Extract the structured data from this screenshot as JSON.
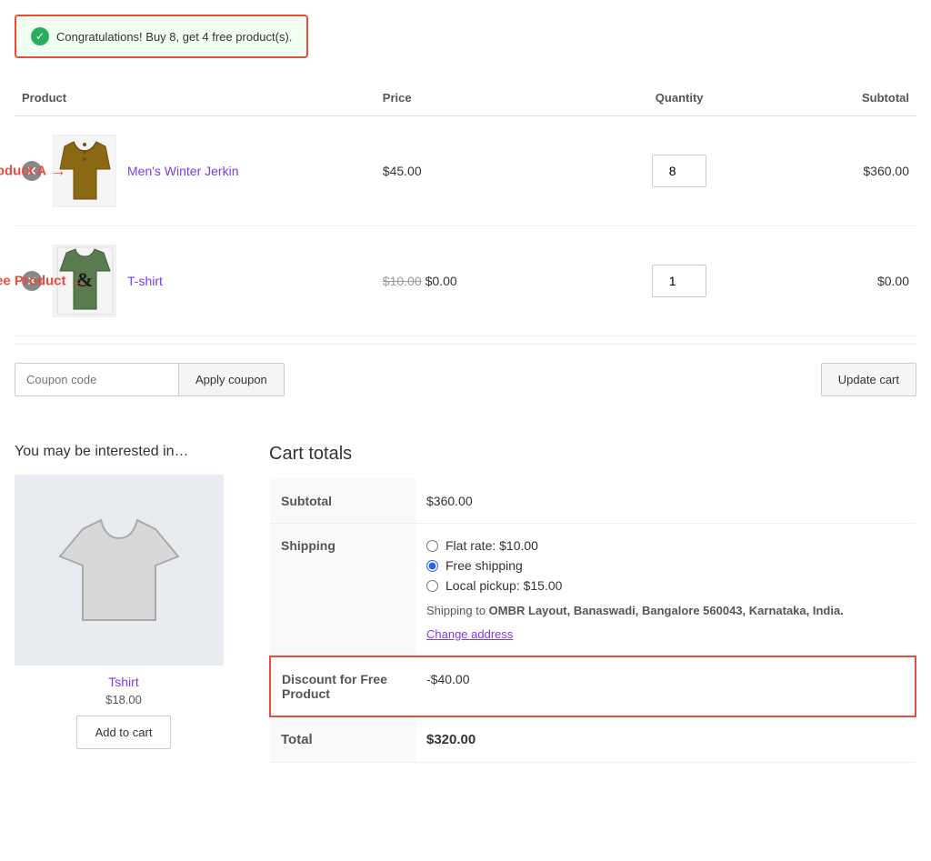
{
  "banner": {
    "message": "Congratulations! Buy 8, get 4 free product(s)."
  },
  "cart": {
    "columns": {
      "product": "Product",
      "price": "Price",
      "quantity": "Quantity",
      "subtotal": "Subtotal"
    },
    "items": [
      {
        "id": "mens-winter-jerkin",
        "name": "Men's Winter Jerkin",
        "price": "$45.00",
        "original_price": null,
        "discounted_price": null,
        "quantity": 8,
        "subtotal": "$360.00",
        "annotation_label": "Product A",
        "annotation_type": "product-a"
      },
      {
        "id": "tshirt",
        "name": "T-shirt",
        "price": null,
        "original_price": "$10.00",
        "discounted_price": "$0.00",
        "quantity": 1,
        "subtotal": "$0.00",
        "annotation_label": "Free Product",
        "annotation_type": "free-product"
      }
    ]
  },
  "coupon": {
    "input_placeholder": "Coupon code",
    "apply_label": "Apply coupon",
    "update_label": "Update cart"
  },
  "interested": {
    "title": "You may be interested in…",
    "product": {
      "name": "Tshirt",
      "price": "$18.00",
      "add_to_cart": "Add to cart"
    }
  },
  "cart_totals": {
    "title": "Cart totals",
    "rows": [
      {
        "label": "Subtotal",
        "value": "$360.00"
      }
    ],
    "shipping": {
      "label": "Shipping",
      "options": [
        {
          "id": "flat-rate",
          "label": "Flat rate: $10.00",
          "selected": false
        },
        {
          "id": "free-shipping",
          "label": "Free shipping",
          "selected": true
        },
        {
          "id": "local-pickup",
          "label": "Local pickup: $15.00",
          "selected": false
        }
      ],
      "address_text": "Shipping to OMBR Layout, Banaswadi, Bangalore 560043, Karnataka, India.",
      "change_address": "Change address"
    },
    "discount": {
      "label": "Discount for Free Product",
      "value": "-$40.00"
    },
    "total": {
      "label": "Total",
      "value": "$320.00"
    }
  }
}
